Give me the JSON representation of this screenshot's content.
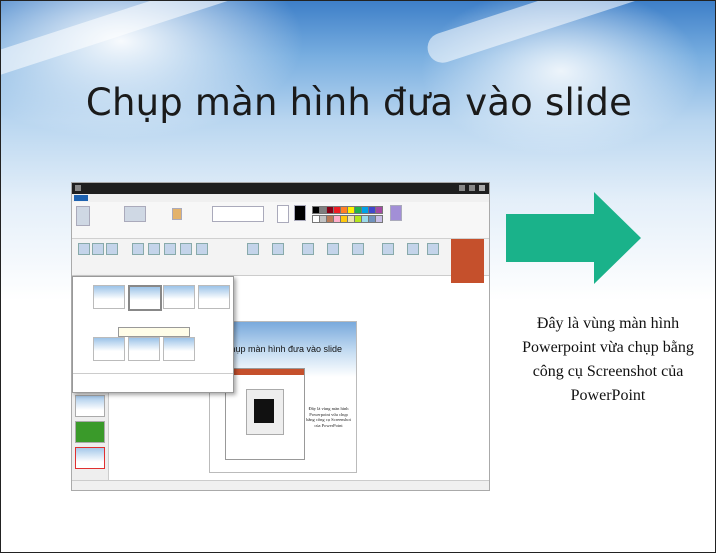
{
  "slide": {
    "title": "Chụp màn hình đưa vào slide",
    "caption": "Đây là vùng màn hình Powerpoint vừa chụp bằng công cụ Screenshot của PowerPoint",
    "arrow_icon": "right-arrow-icon",
    "arrow_color": "#1ab28a"
  },
  "screenshot": {
    "inner_slide_title": "Chụp màn hình đưa vào slide"
  }
}
